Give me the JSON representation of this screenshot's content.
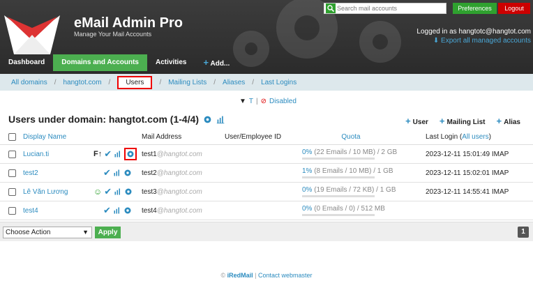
{
  "header": {
    "title": "eMail Admin Pro",
    "subtitle": "Manage Your Mail Accounts",
    "search_placeholder": "Search mail accounts",
    "preferences": "Preferences",
    "logout": "Logout",
    "logged_in": "Logged in as hangtotc@hangtot.com",
    "export": "Export all managed accounts",
    "brand_color": "#4caf50",
    "logout_color": "#cc0000"
  },
  "nav": [
    "Dashboard",
    "Domains and Accounts",
    "Activities",
    "Add..."
  ],
  "breadcrumb": [
    "All domains",
    "hangtot.com",
    "Users",
    "Mailing Lists",
    "Aliases",
    "Last Logins"
  ],
  "filter": {
    "t": "T",
    "sep": "|",
    "disabled": "Disabled"
  },
  "page_title": "Users under domain: hangtot.com (1-4/4)",
  "actions": {
    "user": "User",
    "mailing_list": "Mailing List",
    "alias": "Alias"
  },
  "table": {
    "headers": {
      "display_name": "Display Name",
      "mail_address": "Mail Address",
      "employee_id": "User/Employee ID",
      "quota": "Quota",
      "last_login": "Last Login (",
      "all_users": "All users",
      "last_login_end": ")"
    },
    "rows": [
      {
        "name": "Lucian.ti",
        "user": "test1",
        "domain": "@hangtot.com",
        "quota_pct": "0%",
        "quota_detail": " (22 Emails / 10 MB) / 2 GB",
        "last_login": "2023-12-11 15:01:49 IMAP"
      },
      {
        "name": "test2",
        "user": "test2",
        "domain": "@hangtot.com",
        "quota_pct": "1%",
        "quota_detail": " (8 Emails / 10 MB) / 1 GB",
        "last_login": "2023-12-11 15:02:01 IMAP"
      },
      {
        "name": "Lê Văn Lương",
        "user": "test3",
        "domain": "@hangtot.com",
        "quota_pct": "0%",
        "quota_detail": " (19 Emails / 72 KB) / 1 GB",
        "last_login": "2023-12-11 14:55:41 IMAP"
      },
      {
        "name": "test4",
        "user": "test4",
        "domain": "@hangtot.com",
        "quota_pct": "0%",
        "quota_detail": " (0 Emails / 0) / 512 MB",
        "last_login": ""
      }
    ]
  },
  "bottom": {
    "choose": "Choose Action",
    "apply": "Apply",
    "page": "1"
  },
  "footer": {
    "brand": "iRedMail",
    "sep": "|",
    "contact": "Contact webmaster",
    "copy": "©"
  }
}
